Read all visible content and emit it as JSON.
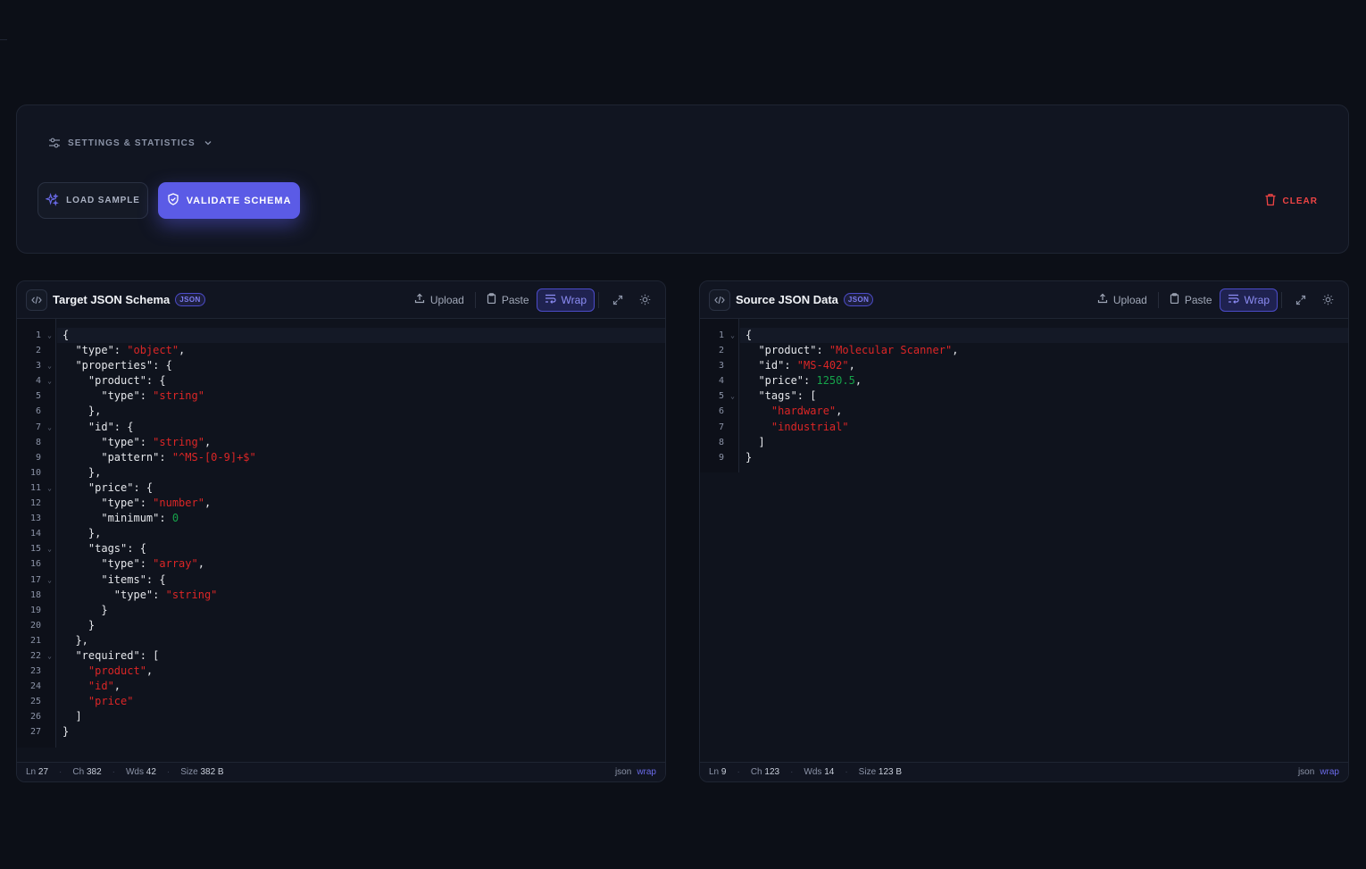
{
  "toolbar": {
    "settings_label": "SETTINGS & STATISTICS",
    "load_sample_label": "LOAD SAMPLE",
    "validate_label": "VALIDATE SCHEMA",
    "clear_label": "CLEAR"
  },
  "colors": {
    "accent": "#5b5be6",
    "danger": "#ef4444",
    "string": "#dc2626",
    "number": "#16a34a",
    "background": "#0c0f17"
  },
  "editors": {
    "left": {
      "title": "Target JSON Schema",
      "badge": "JSON",
      "upload_label": "Upload",
      "paste_label": "Paste",
      "wrap_label": "Wrap",
      "stats": {
        "ln_label": "Ln",
        "ln": "27",
        "ch_label": "Ch",
        "ch": "382",
        "wds_label": "Wds",
        "wds": "42",
        "size_label": "Size",
        "size": "382 B"
      },
      "lang": "json",
      "wrap_mode": "wrap",
      "fold_lines": [
        1,
        3,
        4,
        7,
        11,
        15,
        17,
        22
      ],
      "lines": [
        [
          [
            "k",
            "{"
          ]
        ],
        [
          [
            "k",
            "  \"type\": "
          ],
          [
            "s",
            "\"object\""
          ],
          [
            "k",
            ","
          ]
        ],
        [
          [
            "k",
            "  \"properties\": {"
          ]
        ],
        [
          [
            "k",
            "    \"product\": {"
          ]
        ],
        [
          [
            "k",
            "      \"type\": "
          ],
          [
            "s",
            "\"string\""
          ]
        ],
        [
          [
            "k",
            "    },"
          ]
        ],
        [
          [
            "k",
            "    \"id\": {"
          ]
        ],
        [
          [
            "k",
            "      \"type\": "
          ],
          [
            "s",
            "\"string\""
          ],
          [
            "k",
            ","
          ]
        ],
        [
          [
            "k",
            "      \"pattern\": "
          ],
          [
            "s",
            "\"^MS-[0-9]+$\""
          ]
        ],
        [
          [
            "k",
            "    },"
          ]
        ],
        [
          [
            "k",
            "    \"price\": {"
          ]
        ],
        [
          [
            "k",
            "      \"type\": "
          ],
          [
            "s",
            "\"number\""
          ],
          [
            "k",
            ","
          ]
        ],
        [
          [
            "k",
            "      \"minimum\": "
          ],
          [
            "n",
            "0"
          ]
        ],
        [
          [
            "k",
            "    },"
          ]
        ],
        [
          [
            "k",
            "    \"tags\": {"
          ]
        ],
        [
          [
            "k",
            "      \"type\": "
          ],
          [
            "s",
            "\"array\""
          ],
          [
            "k",
            ","
          ]
        ],
        [
          [
            "k",
            "      \"items\": {"
          ]
        ],
        [
          [
            "k",
            "        \"type\": "
          ],
          [
            "s",
            "\"string\""
          ]
        ],
        [
          [
            "k",
            "      }"
          ]
        ],
        [
          [
            "k",
            "    }"
          ]
        ],
        [
          [
            "k",
            "  },"
          ]
        ],
        [
          [
            "k",
            "  \"required\": ["
          ]
        ],
        [
          [
            "s",
            "    \"product\""
          ],
          [
            "k",
            ","
          ]
        ],
        [
          [
            "s",
            "    \"id\""
          ],
          [
            "k",
            ","
          ]
        ],
        [
          [
            "s",
            "    \"price\""
          ]
        ],
        [
          [
            "k",
            "  ]"
          ]
        ],
        [
          [
            "k",
            "}"
          ]
        ]
      ]
    },
    "right": {
      "title": "Source JSON Data",
      "badge": "JSON",
      "upload_label": "Upload",
      "paste_label": "Paste",
      "wrap_label": "Wrap",
      "stats": {
        "ln_label": "Ln",
        "ln": "9",
        "ch_label": "Ch",
        "ch": "123",
        "wds_label": "Wds",
        "wds": "14",
        "size_label": "Size",
        "size": "123 B"
      },
      "lang": "json",
      "wrap_mode": "wrap",
      "fold_lines": [
        1,
        5
      ],
      "lines": [
        [
          [
            "k",
            "{"
          ]
        ],
        [
          [
            "k",
            "  \"product\": "
          ],
          [
            "s",
            "\"Molecular Scanner\""
          ],
          [
            "k",
            ","
          ]
        ],
        [
          [
            "k",
            "  \"id\": "
          ],
          [
            "s",
            "\"MS-402\""
          ],
          [
            "k",
            ","
          ]
        ],
        [
          [
            "k",
            "  \"price\": "
          ],
          [
            "n",
            "1250.5"
          ],
          [
            "k",
            ","
          ]
        ],
        [
          [
            "k",
            "  \"tags\": ["
          ]
        ],
        [
          [
            "s",
            "    \"hardware\""
          ],
          [
            "k",
            ","
          ]
        ],
        [
          [
            "s",
            "    \"industrial\""
          ]
        ],
        [
          [
            "k",
            "  ]"
          ]
        ],
        [
          [
            "k",
            "}"
          ]
        ]
      ]
    }
  }
}
